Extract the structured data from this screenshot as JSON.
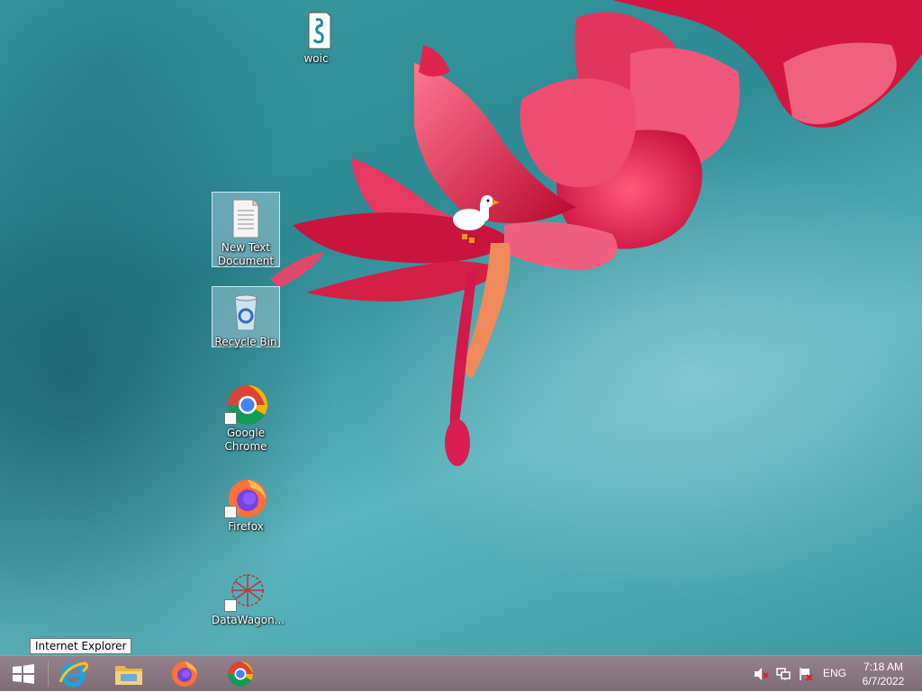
{
  "desktop": {
    "icons": [
      {
        "name": "woic",
        "label": "woic"
      },
      {
        "name": "new-text-document",
        "label": "New Text\nDocument"
      },
      {
        "name": "recycle-bin",
        "label": "Recycle Bin"
      },
      {
        "name": "google-chrome",
        "label": "Google\nChrome"
      },
      {
        "name": "firefox",
        "label": "Firefox"
      },
      {
        "name": "datawagon",
        "label": "DataWagon..."
      }
    ],
    "mascot": "goose-icon"
  },
  "tooltip": {
    "text": "Internet Explorer"
  },
  "taskbar": {
    "start_icon": "windows-logo-icon",
    "pinned": [
      {
        "name": "internet-explorer",
        "icon": "internet-explorer-icon"
      },
      {
        "name": "file-explorer",
        "icon": "folder-icon"
      },
      {
        "name": "firefox",
        "icon": "firefox-icon"
      },
      {
        "name": "google-chrome",
        "icon": "chrome-icon"
      }
    ],
    "tray": {
      "icons": [
        "speaker-muted-icon",
        "network-icon",
        "action-center-flag-icon"
      ],
      "language": "ENG",
      "time": "7:18 AM",
      "date": "6/7/2022"
    },
    "colors": {
      "background": "#8b7882"
    }
  }
}
